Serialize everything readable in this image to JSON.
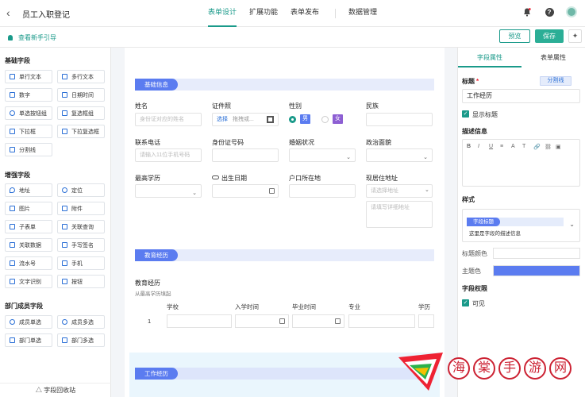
{
  "app": {
    "title": "员工入职登记"
  },
  "nav": {
    "tabs": [
      "表单设计",
      "扩展功能",
      "表单发布",
      "数据管理"
    ],
    "active": 0
  },
  "subbar": {
    "guide": "查看新手引导",
    "preview": "预览",
    "save": "保存"
  },
  "left": {
    "basic_title": "基础字段",
    "basic": [
      "单行文本",
      "多行文本",
      "数字",
      "日期时间",
      "单选按钮组",
      "复选框组",
      "下拉框",
      "下拉复选框",
      "分割线"
    ],
    "enhanced_title": "增强字段",
    "enhanced": [
      "地址",
      "定位",
      "图片",
      "附件",
      "子表单",
      "关联查询",
      "关联数据",
      "手写签名",
      "流水号",
      "手机",
      "文字识别",
      "按钮"
    ],
    "dept_title": "部门成员字段",
    "dept": [
      "成员单选",
      "成员多选",
      "部门单选",
      "部门多选"
    ],
    "recycle": "字段回收站"
  },
  "canvas": {
    "sec1": "基础信息",
    "name_label": "姓名",
    "name_ph": "身份证对应的姓名",
    "idcard_label": "证件照",
    "idcard_choose": "选择",
    "idcard_ph": "拖拽或...",
    "gender_label": "性别",
    "gender_male": "男",
    "gender_female": "女",
    "nation_label": "民族",
    "phone_label": "联系电话",
    "phone_ph": "请输入11位手机号码",
    "idnum_label": "身份证号码",
    "marital_label": "婚姻状况",
    "politics_label": "政治面貌",
    "edu_label": "最高学历",
    "entry_label": "出生日期",
    "hukou_label": "户口所在地",
    "addr_label": "现居住地址",
    "addr_ph": "请选择地址",
    "addr_detail_ph": "请填写详细地址",
    "sec2": "教育经历",
    "edu_table_label": "教育经历",
    "edu_table_hint": "从最高学历填起",
    "edu_cols": [
      "学校",
      "入学时间",
      "毕业时间",
      "专业",
      "学历"
    ],
    "edu_row": "1",
    "sec3": "工作经历"
  },
  "right": {
    "tabs": [
      "字段属性",
      "表单属性"
    ],
    "title_label": "标题",
    "divider_btn": "分割线",
    "title_value": "工作经历",
    "show_title": "显示标题",
    "desc_label": "描述信息",
    "toolbar": [
      "B",
      "I",
      "U",
      "≡",
      "A",
      "T",
      "🔗",
      "⛓",
      "▣"
    ],
    "style_label": "样式",
    "style_pill": "字段标题",
    "style_desc": "这里是字段的描述信息",
    "title_color_label": "标题颜色",
    "theme_color_label": "主题色",
    "theme_color": "#5b7cf0",
    "perm_label": "字段权限",
    "visible": "可见"
  },
  "watermark": {
    "chars": [
      "海",
      "棠",
      "手",
      "游",
      "网"
    ]
  },
  "colors": {
    "accent": "#1a9a8a",
    "primary": "#5b7cf0"
  }
}
